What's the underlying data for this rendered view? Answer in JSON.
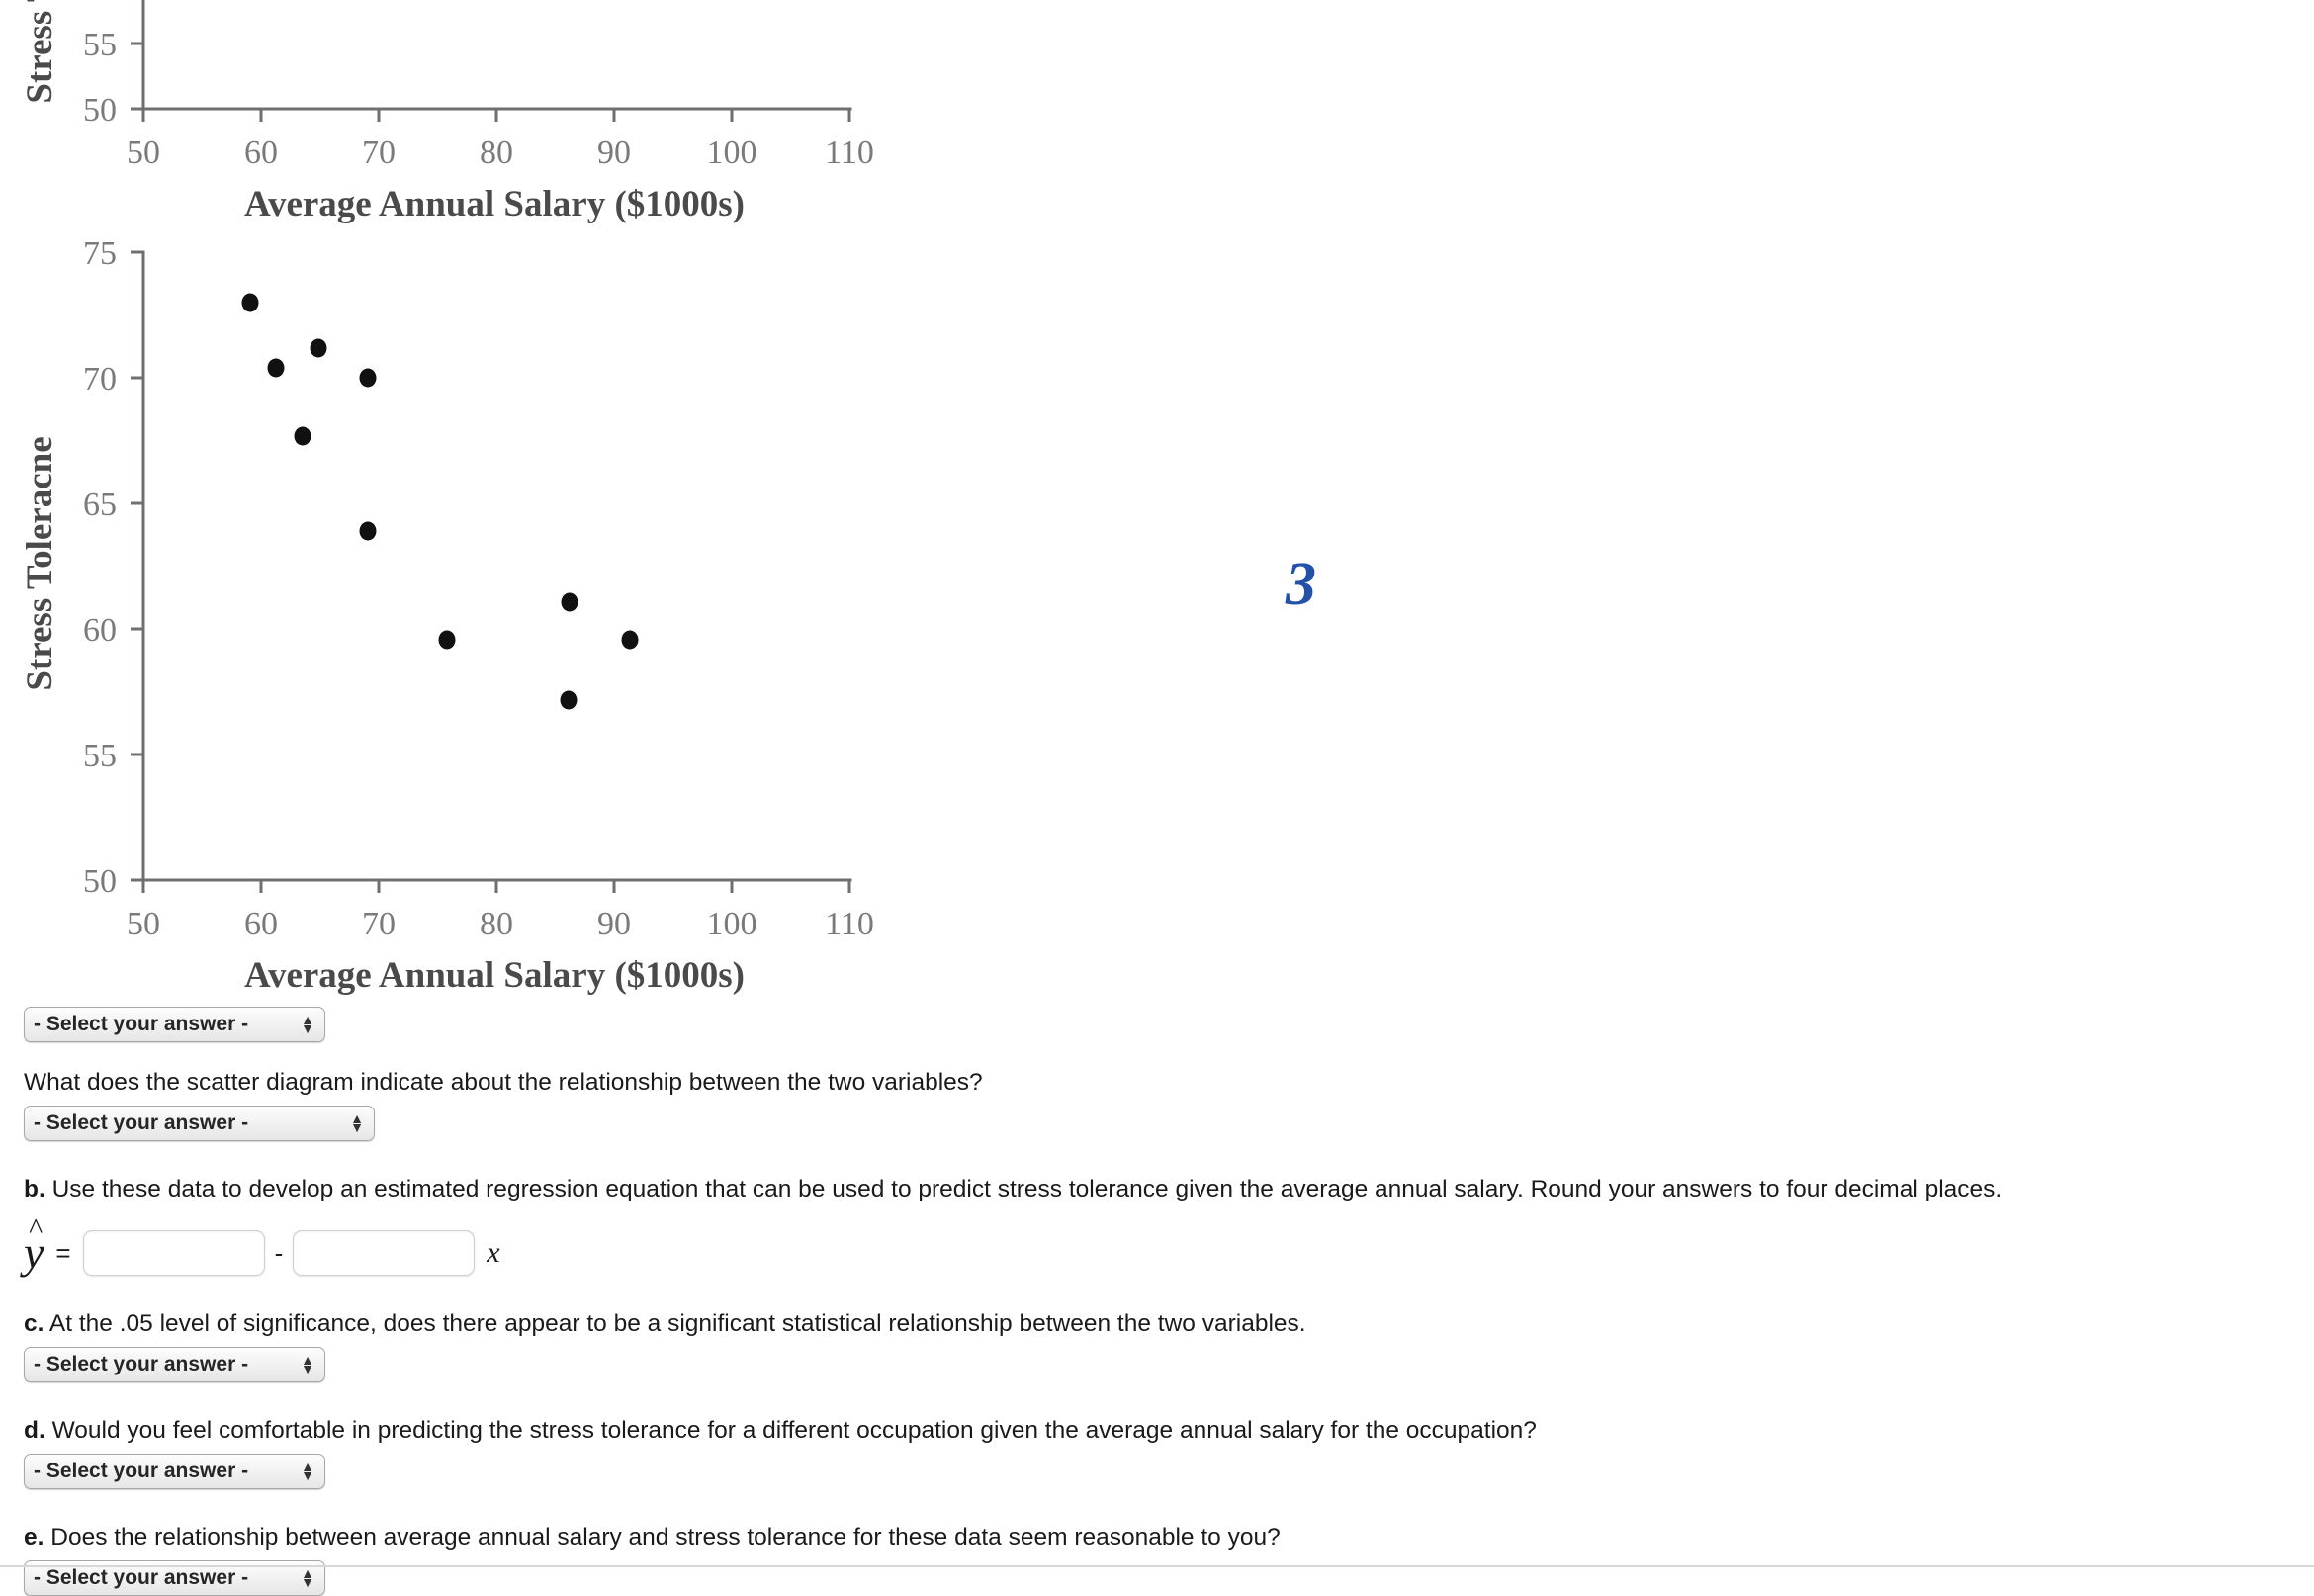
{
  "chart_data": [
    {
      "type": "scatter",
      "title": "",
      "xlabel": "Average Annual Salary ($1000s)",
      "ylabel": "Stress Toleracne",
      "xlim": [
        50,
        110
      ],
      "ylim": [
        50,
        75
      ],
      "xticks": [
        50,
        60,
        70,
        80,
        90,
        100,
        110
      ],
      "yticks": [
        50,
        55
      ],
      "grid": false,
      "clipped": true,
      "note": "Top chart is cut off at the top of the screenshot; only the 55 and 50 y ticks and the x axis are visible. No data points visible.",
      "points": []
    },
    {
      "type": "scatter",
      "title": "",
      "xlabel": "Average Annual Salary ($1000s)",
      "ylabel": "Stress Toleracne",
      "xlim": [
        50,
        110
      ],
      "ylim": [
        50,
        75
      ],
      "xticks": [
        50,
        60,
        70,
        80,
        90,
        100,
        110
      ],
      "yticks": [
        50,
        55,
        60,
        65,
        70,
        75
      ],
      "grid": false,
      "x": [
        59.1,
        61.3,
        64.9,
        63.6,
        69.2,
        69.2,
        75.9,
        86.4,
        86.3,
        91.6
      ],
      "y": [
        71.1,
        68.5,
        69.3,
        65.8,
        68.0,
        61.9,
        57.6,
        59.1,
        55.2,
        57.6
      ],
      "points": [
        {
          "x": 59.1,
          "y": 71.1
        },
        {
          "x": 61.3,
          "y": 68.5
        },
        {
          "x": 64.9,
          "y": 69.3
        },
        {
          "x": 63.6,
          "y": 65.8
        },
        {
          "x": 69.2,
          "y": 68.0
        },
        {
          "x": 69.2,
          "y": 61.9
        },
        {
          "x": 75.9,
          "y": 57.6
        },
        {
          "x": 86.4,
          "y": 59.1
        },
        {
          "x": 86.3,
          "y": 55.2
        },
        {
          "x": 91.6,
          "y": 57.6
        }
      ]
    }
  ],
  "charts": {
    "top": {
      "xlabel": "Average Annual Salary ($1000s)",
      "ylabel": "Stress Toleracne",
      "xticks": [
        "50",
        "60",
        "70",
        "80",
        "90",
        "100",
        "110"
      ],
      "yticks": [
        "55",
        "50"
      ]
    },
    "bottom": {
      "xlabel": "Average Annual Salary ($1000s)",
      "ylabel": "Stress Toleracne",
      "xticks": [
        "50",
        "60",
        "70",
        "80",
        "90",
        "100",
        "110"
      ],
      "yticks": [
        "75",
        "70",
        "65",
        "60",
        "55",
        "50"
      ]
    }
  },
  "annotation": {
    "value": "3",
    "color": "#2350a8"
  },
  "questions": {
    "select_placeholder": "- Select your answer -",
    "top_select_value": "- Select your answer -",
    "a_followup_text": "What does the scatter diagram indicate about the relationship between the two variables?",
    "a_followup_select_value": "- Select your answer -",
    "b": {
      "label": "b.",
      "text": "Use these data to develop an estimated regression equation that can be used to predict stress tolerance given the average annual salary. Round your answers to four decimal places.",
      "yhat_symbol": "y",
      "equals": "=",
      "minus": "-",
      "x_symbol": "x",
      "intercept_value": "",
      "slope_value": "",
      "intercept_placeholder": "",
      "slope_placeholder": ""
    },
    "c": {
      "label": "c.",
      "text": "At the .05 level of significance, does there appear to be a significant statistical relationship between the two variables.",
      "select_value": "- Select your answer -"
    },
    "d": {
      "label": "d.",
      "text": "Would you feel comfortable in predicting the stress tolerance for a different occupation given the average annual salary for the occupation?",
      "select_value": "- Select your answer -"
    },
    "e": {
      "label": "e.",
      "text": "Does the relationship between average annual salary and stress tolerance for these data seem reasonable to you?",
      "select_value": "- Select your answer -"
    }
  }
}
